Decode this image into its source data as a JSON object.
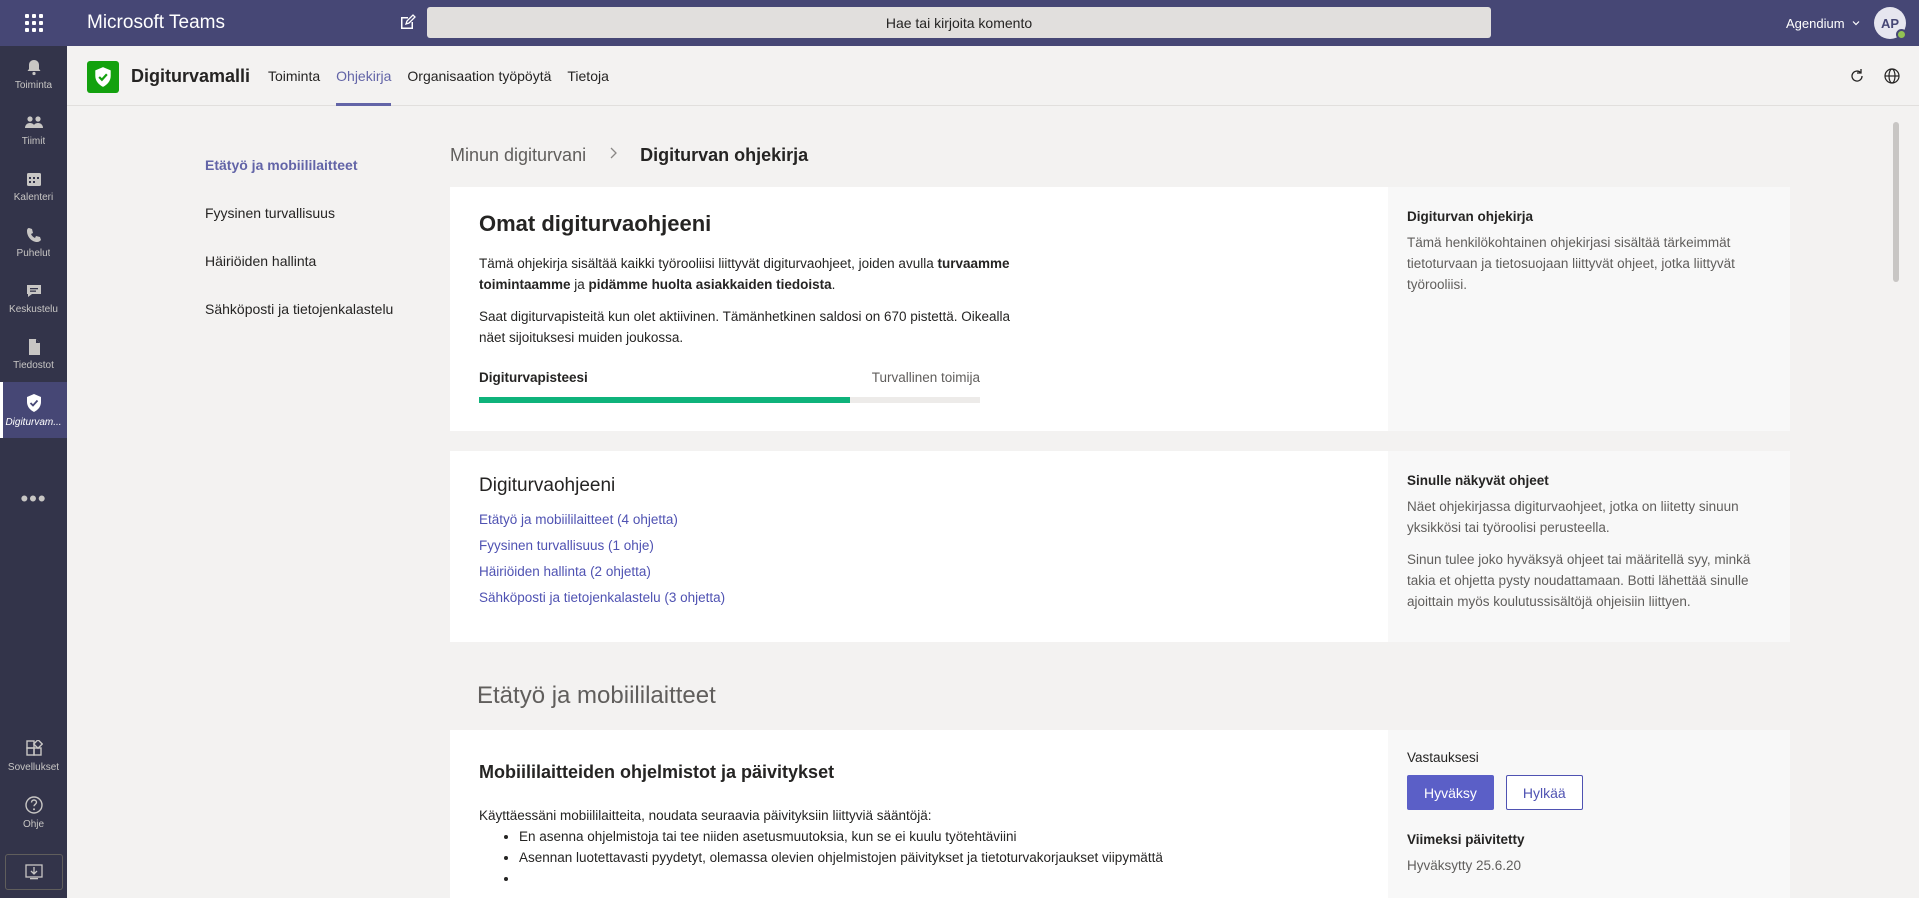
{
  "topbar": {
    "app_title": "Microsoft Teams",
    "search_placeholder": "Hae tai kirjoita komento",
    "org_name": "Agendium",
    "avatar_initials": "AP"
  },
  "rail": {
    "items": [
      {
        "label": "Toiminta",
        "icon": "bell-icon"
      },
      {
        "label": "Tiimit",
        "icon": "teams-icon"
      },
      {
        "label": "Kalenteri",
        "icon": "calendar-icon"
      },
      {
        "label": "Puhelut",
        "icon": "phone-icon"
      },
      {
        "label": "Keskustelu",
        "icon": "chat-icon"
      },
      {
        "label": "Tiedostot",
        "icon": "file-icon"
      },
      {
        "label": "Digiturvam...",
        "icon": "shield-icon"
      }
    ],
    "more": "•••",
    "bottom": [
      {
        "label": "Sovellukset",
        "icon": "apps-icon"
      },
      {
        "label": "Ohje",
        "icon": "help-icon"
      }
    ]
  },
  "appheader": {
    "name": "Digiturvamalli",
    "tabs": [
      "Toiminta",
      "Ohjekirja",
      "Organisaation työpöytä",
      "Tietoja"
    ]
  },
  "sidenav": {
    "items": [
      "Etätyö ja mobiililaitteet",
      "Fyysinen turvallisuus",
      "Häiriöiden hallinta",
      "Sähköposti ja tietojenkalastelu"
    ]
  },
  "breadcrumb": {
    "parent": "Minun digiturvani",
    "current": "Digiturvan ohjekirja"
  },
  "card1": {
    "title": "Omat digiturvaohjeeni",
    "p1_a": "Tämä ohjekirja sisältää kaikki työrooliisi liittyvät digiturvaohjeet, joiden avulla ",
    "p1_b": "turvaamme toimintaamme",
    "p1_c": " ja ",
    "p1_d": "pidämme huolta asiakkaiden tiedoista",
    "p1_e": ".",
    "p2": "Saat digiturvapisteitä kun olet aktiivinen. Tämänhetkinen saldosi on 670 pistettä. Oikealla näet sijoituksesi muiden joukossa.",
    "progress_label": "Digiturvapisteesi",
    "progress_level": "Turvallinen toimija",
    "progress_fraction": 0.74,
    "side_title": "Digiturvan ohjekirja",
    "side_text": "Tämä henkilökohtainen ohjekirjasi sisältää tärkeimmät tietoturvaan ja tietosuojaan liittyvät ohjeet, jotka liittyvät työrooliisi."
  },
  "card2": {
    "title": "Digiturvaohjeeni",
    "links": [
      "Etätyö ja mobiililaitteet (4 ohjetta)",
      "Fyysinen turvallisuus (1 ohje)",
      "Häiriöiden hallinta (2 ohjetta)",
      "Sähköposti ja tietojenkalastelu (3 ohjetta)"
    ],
    "side_title": "Sinulle näkyvät ohjeet",
    "side_text1": "Näet ohjekirjassa digiturvaohjeet, jotka on liitetty sinuun yksikkösi tai työroolisi perusteella.",
    "side_text2": "Sinun tulee joko hyväksyä ohjeet tai määritellä syy, minkä takia et ohjetta pysty noudattamaan. Botti lähettää sinulle ajoittain myös koulutussisältöjä ohjeisiin liittyen."
  },
  "section": {
    "title": "Etätyö ja mobiililaitteet"
  },
  "card3": {
    "title": "Mobiililaitteiden ohjelmistot ja päivitykset",
    "intro": "Käyttäessäni mobiililaitteita, noudata seuraavia päivityksiin liittyviä sääntöjä:",
    "bullets": [
      "En asenna ohjelmistoja tai tee niiden asetusmuutoksia, kun se ei kuulu työtehtäviini",
      "Asennan luotettavasti pyydetyt, olemassa olevien ohjelmistojen päivitykset ja tietoturvakorjaukset viipymättä",
      ""
    ],
    "answers_title": "Vastauksesi",
    "accept": "Hyväksy",
    "reject": "Hylkää",
    "updated_title": "Viimeksi päivitetty",
    "updated_value": "Hyväksytty 25.6.20"
  },
  "colors": {
    "topbar": "#464775",
    "rail": "#33344a",
    "accent": "#6264a7",
    "progress": "#0fb37b"
  }
}
